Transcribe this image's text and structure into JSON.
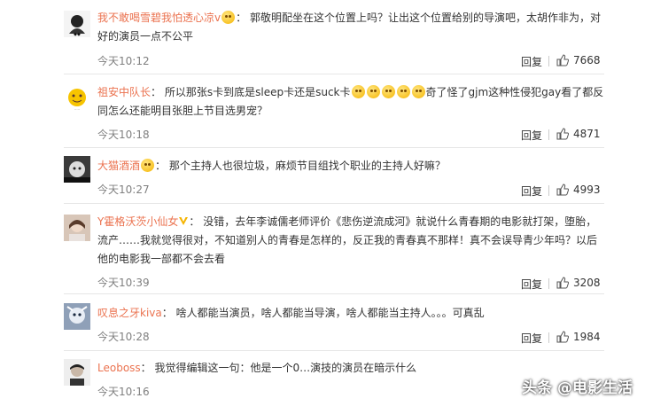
{
  "comments": [
    {
      "user": "我不敢喝雪碧我怕透心凉v",
      "text": "郭敬明配坐在这个位置上吗？让出这个位置给别的导演吧，太胡作非为，对好的演员一点不公平",
      "time": "今天10:12",
      "reply": "回复",
      "likes": "7668"
    },
    {
      "user": "祖安中队长",
      "text_a": "所以那张s卡到底是sleep卡还是suck卡",
      "text_b": "奇了怪了gjm这种性侵犯gay看了都反同怎么还能明目张胆上节目选男宠？",
      "time": "今天10:18",
      "reply": "回复",
      "likes": "4871"
    },
    {
      "user": "大猫酒酒",
      "text": "那个主持人也很垃圾，麻烦节目组找个职业的主持人好嘛？",
      "time": "今天10:27",
      "reply": "回复",
      "likes": "4993"
    },
    {
      "user": "Y霍格沃茨小仙女",
      "text": "没错，去年李诚儒老师评价《悲伤逆流成河》就说什么青春期的电影就打架，堕胎，流产……我就觉得很对，不知道别人的青春是怎样的，反正我的青春真不那样！真不会误导青少年吗？以后他的电影我一部都不会去看",
      "time": "今天10:39",
      "reply": "回复",
      "likes": "3208"
    },
    {
      "user": "叹息之牙kiva",
      "text": "啥人都能当演员，啥人都能当导演，啥人都能当主持人。。。可真乱",
      "time": "今天10:28",
      "reply": "回复",
      "likes": "1984"
    },
    {
      "user": "Leoboss",
      "text": "我觉得编辑这一句：他是一个0…演技的演员在暗示什么",
      "time": "今天10:16"
    }
  ],
  "watermark": "头条 @电影生活",
  "colors": {
    "username": "#eb7350",
    "text": "#333333",
    "time": "#808080"
  }
}
